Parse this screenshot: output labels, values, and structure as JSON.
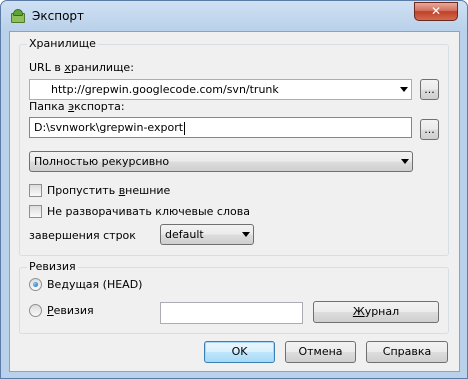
{
  "window": {
    "title": "Экспорт",
    "close_glyph": "✕"
  },
  "repo_group": {
    "label": "Хранилище",
    "url_label": "URL в хранилище:",
    "url_value": "http://grepwin.googlecode.com/svn/trunk",
    "export_label": "Папка экспорта:",
    "export_value": "D:\\svnwork\\grepwin-export",
    "browse_label": "...",
    "depth_value": "Полностью рекурсивно",
    "omit_externals_label": "Пропустить внешние",
    "no_keywords_label": "Не разворачивать ключевые слова",
    "eol_label": "завершения строк",
    "eol_value": "default"
  },
  "revision_group": {
    "label": "Ревизия",
    "head_label": "Ведущая (HEAD)",
    "revision_label": "Ревизия",
    "revision_value": "",
    "log_button": "Журнал"
  },
  "buttons": {
    "ok": "OK",
    "cancel": "Отмена",
    "help": "Справка"
  },
  "icons": {
    "app": "tortoisesvn-icon",
    "close": "close-icon",
    "dropdown": "chevron-down-icon"
  }
}
